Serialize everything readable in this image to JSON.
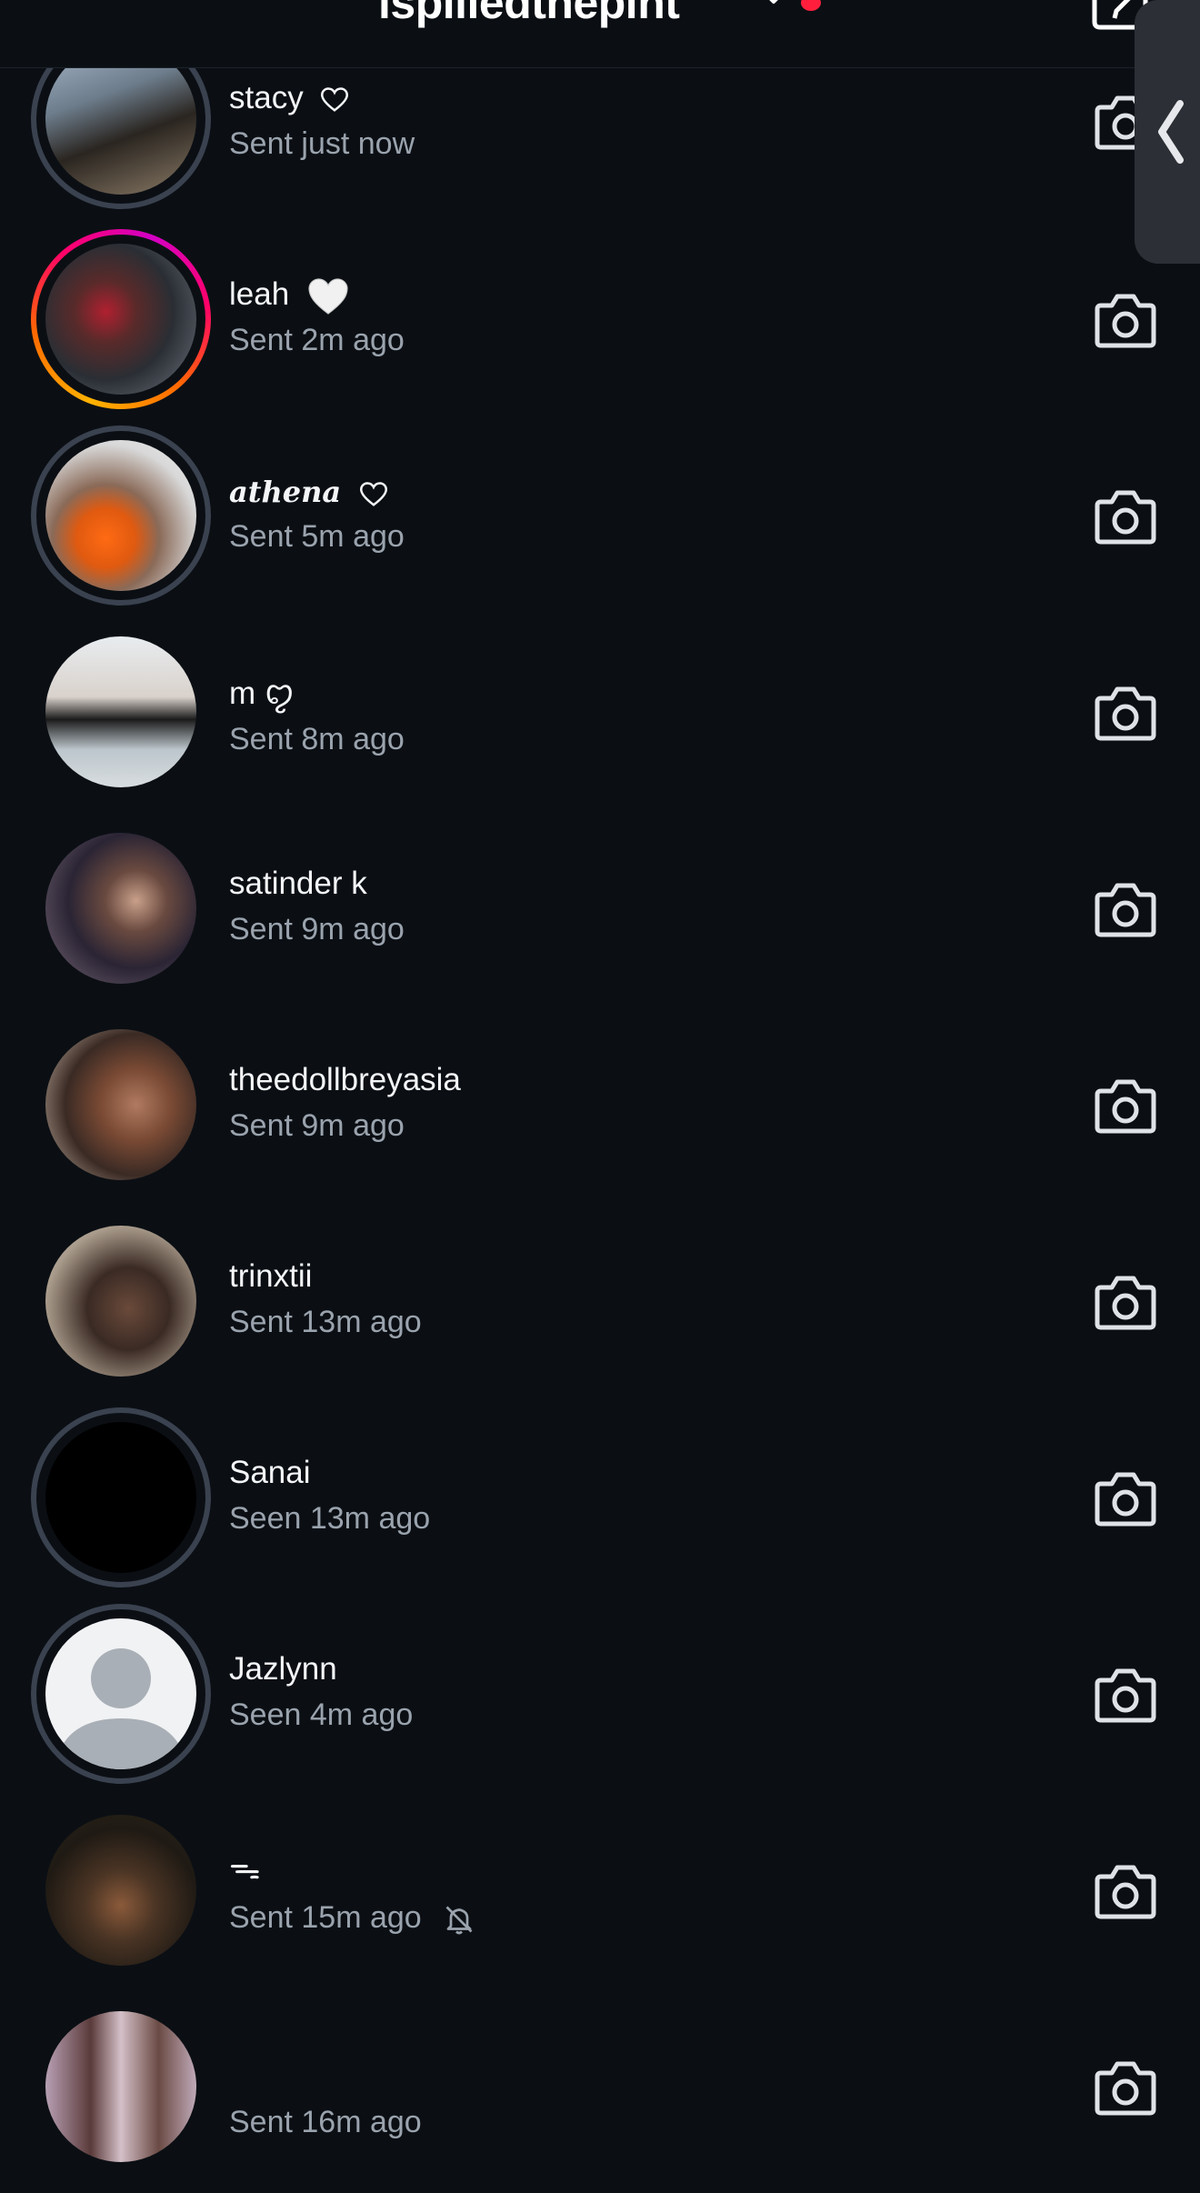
{
  "header": {
    "title": "ispilledthepint",
    "icons": [
      "chevron-down-icon",
      "compose-icon"
    ]
  },
  "rows": [
    {
      "name": "stacy",
      "status": "Sent just now",
      "avatar": "photo",
      "ring": "grey",
      "badge": "heart-outline"
    },
    {
      "name": "leah",
      "status": "Sent 2m ago",
      "avatar": "photo",
      "ring": "story",
      "badge": "white-heart-emoji"
    },
    {
      "name": "athena",
      "status": "Sent 5m ago",
      "avatar": "photo",
      "ring": "grey",
      "badge": "heart-outline"
    },
    {
      "name": "m ꨄ",
      "status": "Sent 8m ago",
      "avatar": "photo",
      "ring": "none"
    },
    {
      "name": "satinder k",
      "status": "Sent 9m ago",
      "avatar": "photo",
      "ring": "none"
    },
    {
      "name": "theedollbreyasia",
      "status": "Sent 9m ago",
      "avatar": "photo",
      "ring": "none"
    },
    {
      "name": "trinxtii",
      "status": "Sent 13m ago",
      "avatar": "photo",
      "ring": "none"
    },
    {
      "name": "Sanai",
      "status": "Seen 13m ago",
      "avatar": "black",
      "ring": "grey"
    },
    {
      "name": "Jazlynn",
      "status": "Seen 4m ago",
      "avatar": "default",
      "ring": "grey"
    },
    {
      "name": "ᯓ",
      "status": "Sent 15m ago",
      "avatar": "photo",
      "ring": "none",
      "muted": true
    },
    {
      "name": "",
      "status": "Sent 16m ago",
      "avatar": "photo",
      "ring": "none"
    }
  ],
  "colors": {
    "background": "#0b0f14",
    "accent_dot": "#ff1f3d",
    "secondary_text": "#9aa3ad"
  }
}
